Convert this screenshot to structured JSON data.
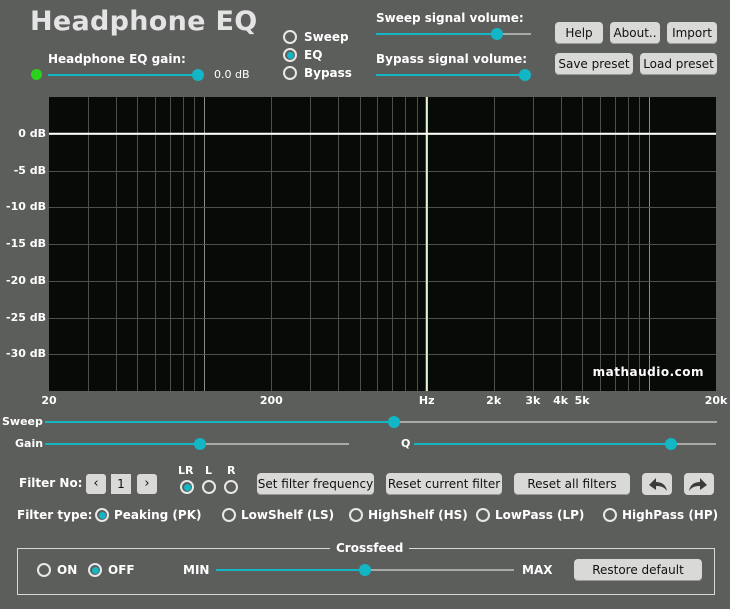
{
  "app": {
    "title": "Headphone EQ",
    "watermark": "mathaudio.com",
    "accent_color": "#12b6c4",
    "plot_background": "#070a06"
  },
  "gain": {
    "label": "Headphone EQ gain:",
    "value": "0.0 dB",
    "slider_fraction": 1.0,
    "indicator_color": "#2bd21c"
  },
  "mode": {
    "options": [
      "Sweep",
      "EQ",
      "Bypass"
    ],
    "selected": "EQ"
  },
  "volumes": {
    "sweep_label": "Sweep signal volume:",
    "sweep_fraction": 0.82,
    "bypass_label": "Bypass signal volume:",
    "bypass_fraction": 1.0
  },
  "buttons": {
    "help": "Help",
    "about": "About..",
    "import": "Import",
    "save_preset": "Save preset",
    "load_preset": "Load preset"
  },
  "graph": {
    "y_ticks": [
      "0 dB",
      "-5 dB",
      "-10 dB",
      "-15 dB",
      "-20 dB",
      "-25 dB",
      "-30 dB"
    ],
    "y_values": [
      0,
      -5,
      -10,
      -15,
      -20,
      -25,
      -30
    ],
    "x_ticks": [
      "20",
      "200",
      "Hz",
      "2k",
      "3k",
      "4k",
      "5k",
      "20k"
    ],
    "x_values": [
      20,
      200,
      1000,
      2000,
      3000,
      4000,
      5000,
      20000
    ],
    "x_range_hz": [
      20,
      20000
    ],
    "y_range_db": [
      -35,
      5
    ],
    "curve_db": 0,
    "marker_hz": 1000
  },
  "controls": {
    "sweep_label": "Sweep",
    "sweep_fraction": 0.52,
    "gain_label": "Gain",
    "gain_fraction": 0.5,
    "q_label": "Q",
    "q_fraction": 0.85
  },
  "filter": {
    "no_label": "Filter No:",
    "no_value": "1",
    "prev_symbol": "‹",
    "next_symbol": "›",
    "channels": [
      "LR",
      "L",
      "R"
    ],
    "channel_selected": "LR",
    "set_frequency": "Set filter frequency",
    "reset_current": "Reset current filter",
    "reset_all": "Reset all filters",
    "undo_icon": "undo-arrow-icon",
    "redo_icon": "redo-arrow-icon"
  },
  "filter_type": {
    "label": "Filter type:",
    "options": [
      "Peaking (PK)",
      "LowShelf (LS)",
      "HighShelf (HS)",
      "LowPass (LP)",
      "HighPass (HP)"
    ],
    "selected": "Peaking (PK)"
  },
  "crossfeed": {
    "title": "Crossfeed",
    "on_label": "ON",
    "off_label": "OFF",
    "selected": "OFF",
    "min_label": "MIN",
    "max_label": "MAX",
    "slider_fraction": 0.5,
    "restore_label": "Restore default"
  }
}
